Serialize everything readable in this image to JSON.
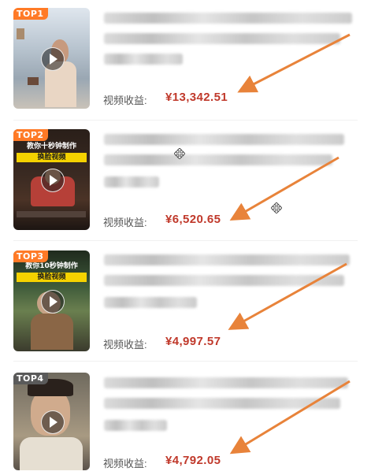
{
  "items": [
    {
      "rank": "TOP1",
      "earnings_label": "视频收益:",
      "earnings_value": "¥13,342.51"
    },
    {
      "rank": "TOP2",
      "thumb_text_1": "教你十秒钟制作",
      "thumb_text_2": "换脸视频",
      "earnings_label": "视频收益:",
      "earnings_value": "¥6,520.65"
    },
    {
      "rank": "TOP3",
      "thumb_text_1": "教你10秒钟制作",
      "thumb_text_2": "换脸视频",
      "earnings_label": "视频收益:",
      "earnings_value": "¥4,997.57"
    },
    {
      "rank": "TOP4",
      "earnings_label": "视频收益:",
      "earnings_value": "¥4,792.05"
    }
  ],
  "colors": {
    "badge": "#ff7a26",
    "earnings": "#c0392b",
    "arrow": "#e8833a"
  },
  "icons": [
    "play-icon",
    "move-cursor-icon"
  ]
}
